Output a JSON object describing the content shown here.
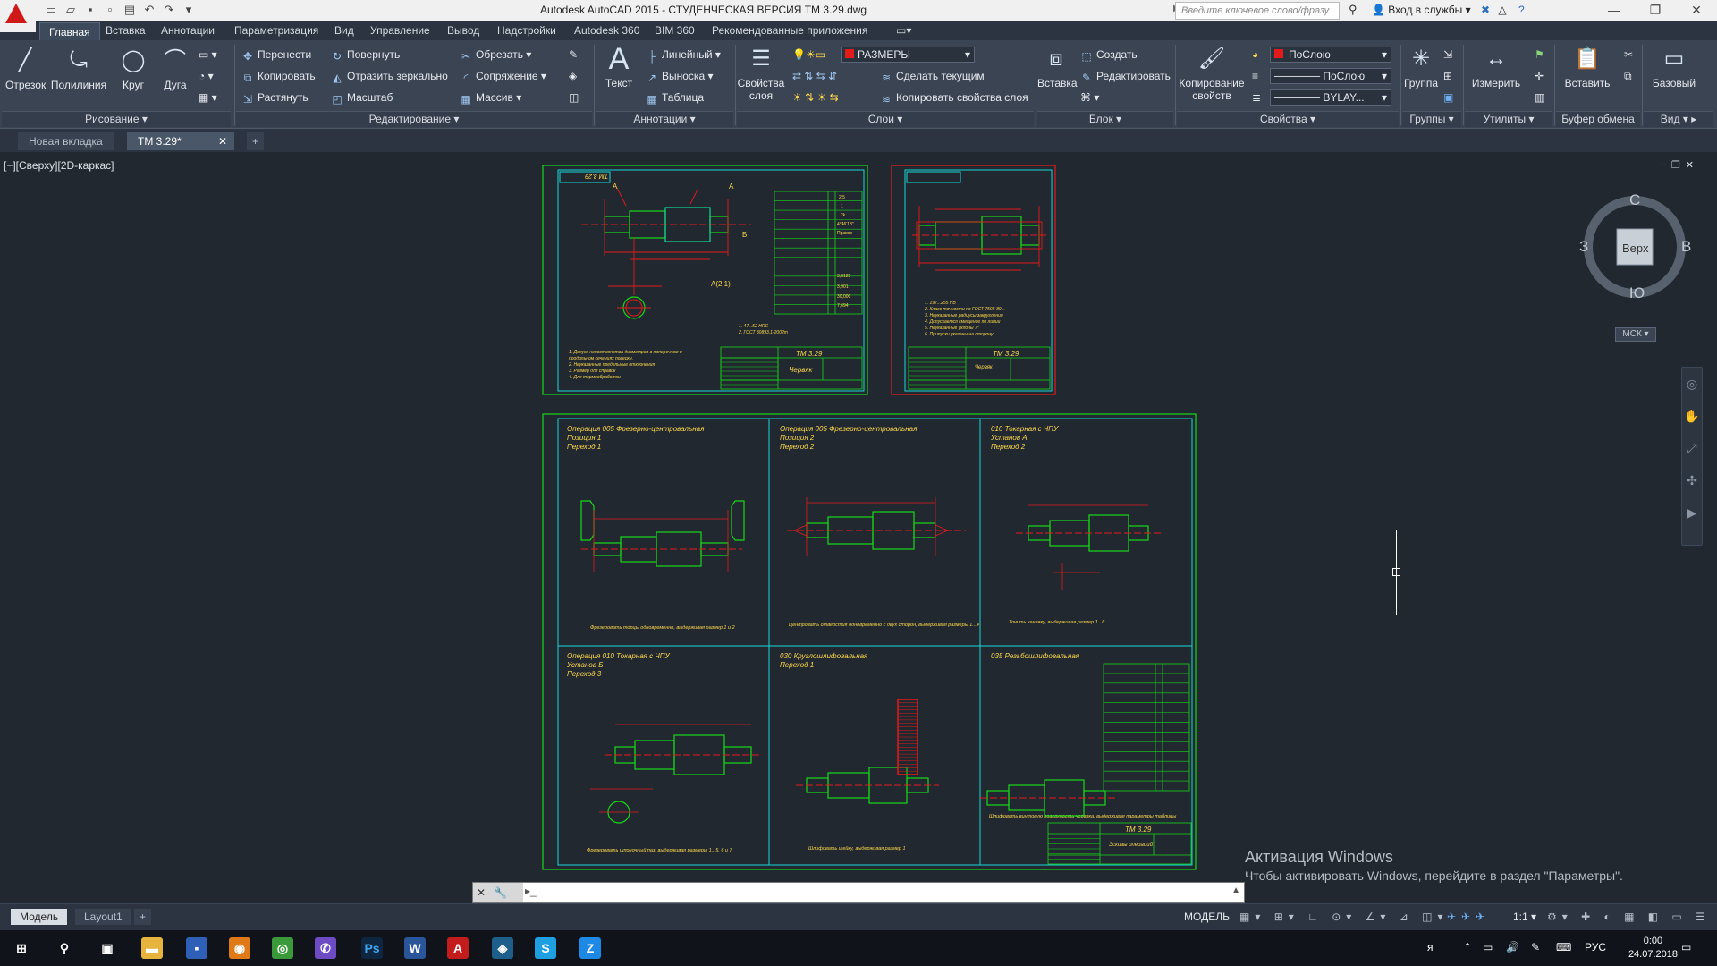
{
  "titlebar": {
    "title": "Autodesk AutoCAD 2015 - СТУДЕНЧЕСКАЯ ВЕРСИЯ    ТМ 3.29.dwg",
    "search_placeholder": "Введите ключевое слово/фразу",
    "login": "Вход в службы"
  },
  "menu": {
    "tabs": [
      "Главная",
      "Вставка",
      "Аннотации",
      "Параметризация",
      "Вид",
      "Управление",
      "Вывод",
      "Надстройки",
      "Autodesk 360",
      "BIM 360",
      "Рекомендованные приложения"
    ]
  },
  "ribbon": {
    "draw": {
      "line": "Отрезок",
      "polyline": "Полилиния",
      "circle": "Круг",
      "arc": "Дуга",
      "title": "Рисование"
    },
    "modify": {
      "move": "Перенести",
      "rotate": "Повернуть",
      "trim": "Обрезать",
      "copy": "Копировать",
      "mirror": "Отразить зеркально",
      "fillet": "Сопряжение",
      "stretch": "Растянуть",
      "scale": "Масштаб",
      "array": "Массив",
      "title": "Редактирование"
    },
    "annotation": {
      "text": "Текст",
      "linear": "Линейный",
      "leader": "Выноска",
      "table": "Таблица",
      "title": "Аннотации"
    },
    "layers": {
      "properties_line1": "Свойства",
      "properties_line2": "слоя",
      "current_layer": "РАЗМЕРЫ",
      "make_current": "Сделать текущим",
      "match_layer": "Копировать свойства слоя",
      "title": "Слои"
    },
    "block": {
      "insert": "Вставка",
      "create": "Создать",
      "edit": "Редактировать",
      "title": "Блок"
    },
    "properties": {
      "match_line1": "Копирование",
      "match_line2": "свойств",
      "color": "ПоСлою",
      "linetype": "ПоСлою",
      "lineweight": "BYLAY...",
      "title": "Свойства"
    },
    "groups": {
      "group": "Группа",
      "title": "Группы"
    },
    "utilities": {
      "measure": "Измерить",
      "title": "Утилиты"
    },
    "clipboard": {
      "paste": "Вставить",
      "title": "Буфер обмена"
    },
    "view": {
      "base": "Базовый",
      "title": "Вид"
    }
  },
  "doctabs": {
    "new_tab": "Новая вкладка",
    "current": "ТМ 3.29*"
  },
  "viewport": {
    "label": "[−][Сверху][2D-каркас]",
    "viewcube": {
      "top": "Верх",
      "north": "С",
      "south": "Ю",
      "west": "З",
      "east": "В",
      "wcs": "МСК"
    }
  },
  "drawing": {
    "sheet1_stamp": "TM 3.29",
    "sheet1_part": "Червяк",
    "sheet1_code": "ТМ 3.29",
    "sheet2_stamp": "TM 3.29",
    "sheet2_part": "Червяк",
    "ops": [
      {
        "title": "Операция 005 Фрезерно-центровальная",
        "l2": "Позиция 1",
        "l3": "Переход 1",
        "note": "Фрезеровать торцы одновременно, выдерживая размер 1 и 2"
      },
      {
        "title": "Операция 005 Фрезерно-центровальная",
        "l2": "Позиция 2",
        "l3": "Переход 2",
        "note": "Центровать отверстия одновременно с двух сторон, выдерживая размеры 1...4"
      },
      {
        "title": "010 Токарная с ЧПУ",
        "l2": "Установ А",
        "l3": "Переход 2",
        "note": "Точить канавку, выдерживая размер 1...6"
      },
      {
        "title": "Операция 010 Токарная с ЧПУ",
        "l2": "Установ Б",
        "l3": "Переход 3",
        "note": "Фрезеровать шпоночный паз, выдерживая размеры 1...5, 6 и 7"
      },
      {
        "title": "030 Круглошлифовальная",
        "l2": "Переход 1",
        "l3": "",
        "note": "Шлифовать шейку, выдерживая размер 1"
      },
      {
        "title": "035 Резьбошлифовальная",
        "l2": "",
        "l3": "",
        "note": "Шлифовать винтовую поверхность червяка, выдерживая параметры таблицы"
      }
    ],
    "sheet3_stamp": "TM 3.29",
    "sheet3_part": "Эскизы операций"
  },
  "command": {
    "prompt": "▸_"
  },
  "status": {
    "tabs": [
      "Модель",
      "Layout1"
    ],
    "model": "МОДЕЛЬ",
    "scale": "1:1"
  },
  "watermark": {
    "title": "Активация Windows",
    "text": "Чтобы активировать Windows, перейдите в раздел \"Параметры\"."
  },
  "taskbar": {
    "lang": "РУС",
    "time": "0:00",
    "date": "24.07.2018"
  }
}
